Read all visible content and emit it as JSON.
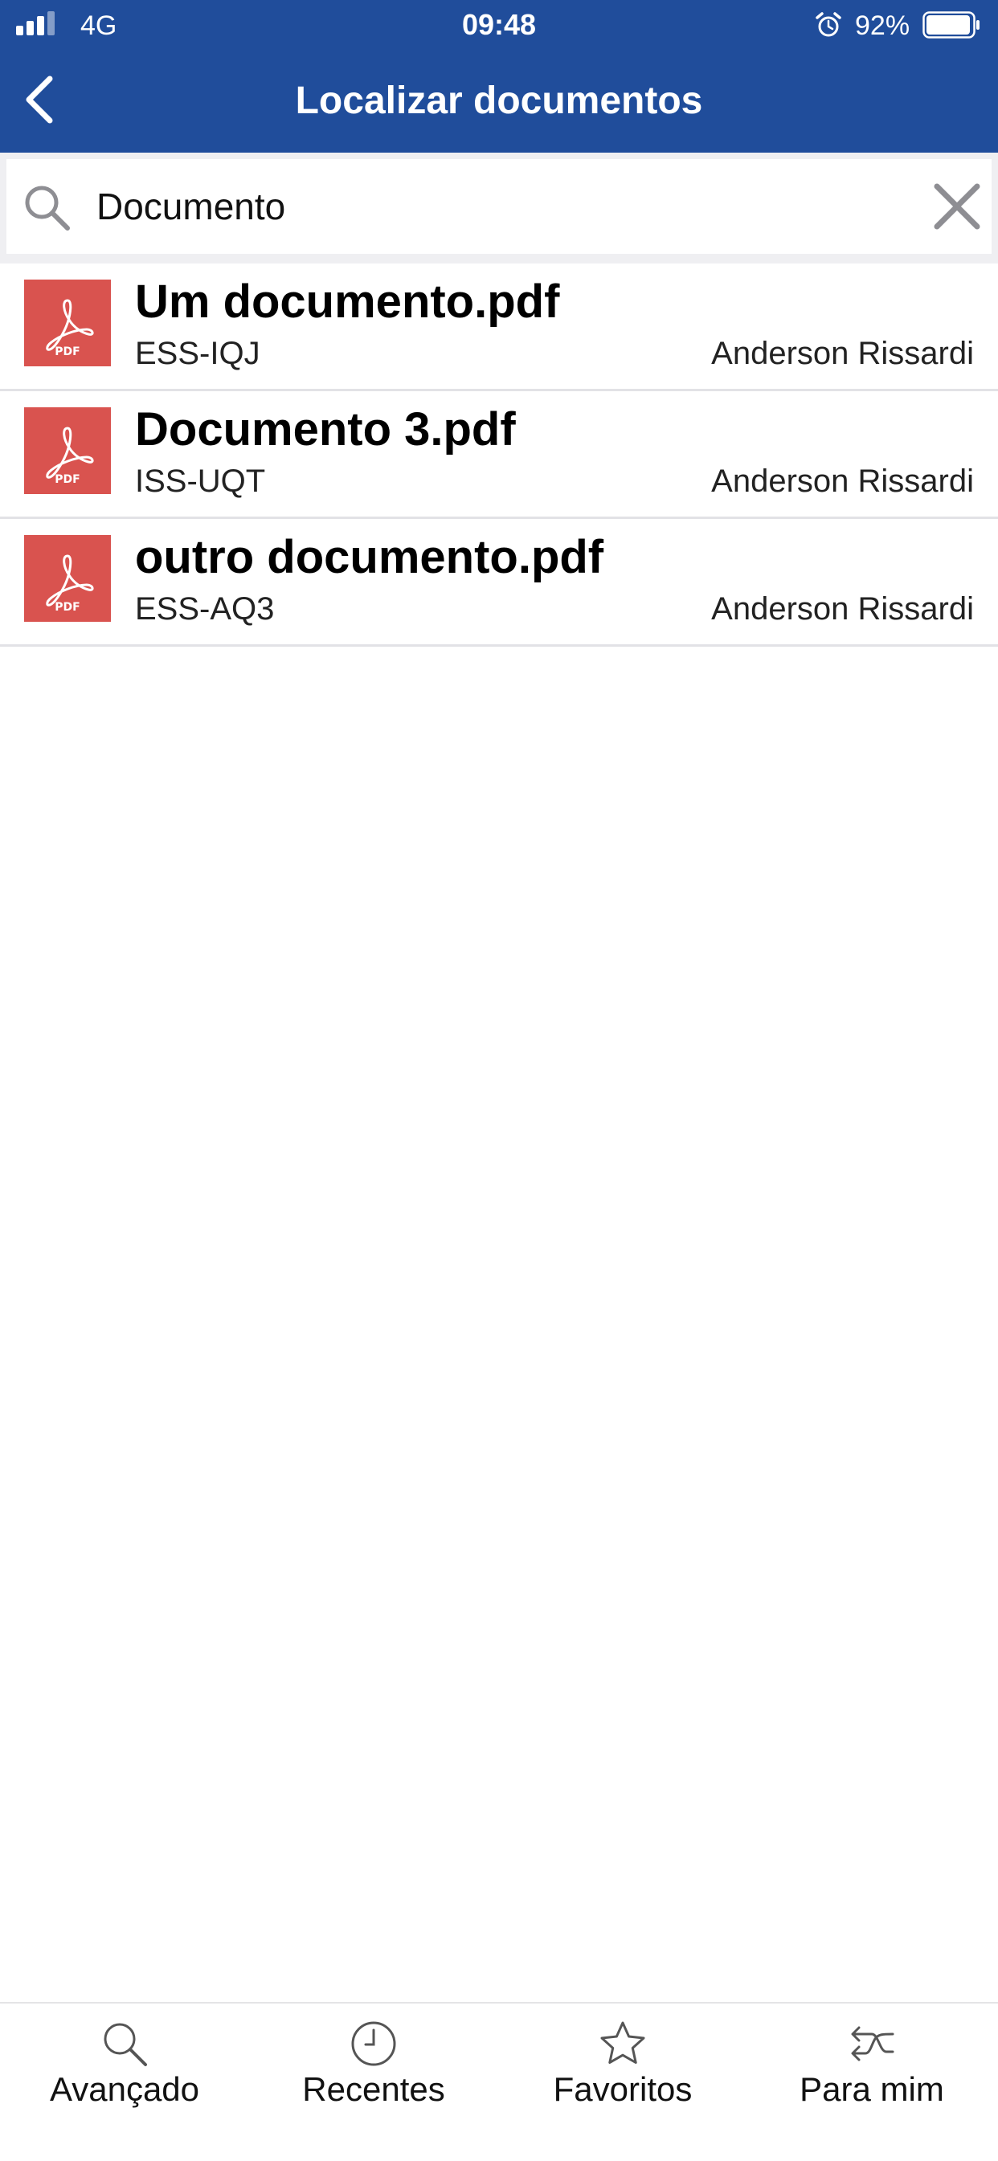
{
  "status_bar": {
    "carrier": "4G",
    "time": "09:48",
    "battery_percent": "92%",
    "icons": [
      "signal-icon",
      "alarm-icon",
      "battery-icon"
    ]
  },
  "nav": {
    "title": "Localizar documentos",
    "back_icon": "chevron-left-icon",
    "background_color": "#204d9b"
  },
  "search": {
    "value": "Documento",
    "icon": "search-icon",
    "clear_icon": "close-icon"
  },
  "results": [
    {
      "name": "Um documento.pdf",
      "code": "ESS-IQJ",
      "author": "Anderson Rissardi",
      "type_icon": "pdf-file-icon"
    },
    {
      "name": "Documento 3.pdf",
      "code": "ISS-UQT",
      "author": "Anderson Rissardi",
      "type_icon": "pdf-file-icon"
    },
    {
      "name": "outro documento.pdf",
      "code": "ESS-AQ3",
      "author": "Anderson Rissardi",
      "type_icon": "pdf-file-icon"
    }
  ],
  "tabs": [
    {
      "label": "Avançado",
      "icon": "search-icon"
    },
    {
      "label": "Recentes",
      "icon": "clock-icon"
    },
    {
      "label": "Favoritos",
      "icon": "star-icon"
    },
    {
      "label": "Para mim",
      "icon": "share-arrows-icon"
    }
  ],
  "colors": {
    "header": "#204d9b",
    "pdf_icon": "#d9534f",
    "search_background": "#efeff2"
  }
}
